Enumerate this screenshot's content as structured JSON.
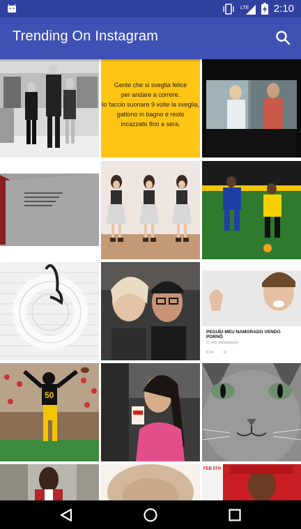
{
  "status_bar": {
    "time": "2:10",
    "network": "LTE",
    "icons": [
      "android-notification-icon",
      "vibrate-icon",
      "lte-signal-icon",
      "battery-charging-icon"
    ]
  },
  "app_bar": {
    "title": "Trending On Instagram",
    "search_icon": "search-icon"
  },
  "tiles": [
    {
      "subject": "fashion-group-photo"
    },
    {
      "subject": "quote-card",
      "quote_lines": [
        "Gente che si sveglia felice",
        "per andare a correre.",
        "Io faccio suonare 9 volte la sveglia,",
        "gattono in bagno e resto",
        "incazzato fino a sera."
      ]
    },
    {
      "subject": "tv-show-still"
    },
    {
      "subject": "notebook-photo"
    },
    {
      "subject": "mirror-selfie-collage"
    },
    {
      "subject": "soccer-match"
    },
    {
      "subject": "lifebuoy-on-wall"
    },
    {
      "subject": "couple-selfie"
    },
    {
      "subject": "video-thumbnail",
      "caption": "PEGUEI MEU NAMORADO VENDO PORNÔ",
      "sub": "27.400 visualizações",
      "likes": "8 mil",
      "comments": "67"
    },
    {
      "subject": "football-player"
    },
    {
      "subject": "car-selfie-coffee"
    },
    {
      "subject": "cat-closeup"
    },
    {
      "subject": "man-portrait"
    },
    {
      "subject": "lion-closeup"
    },
    {
      "subject": "magazine-cover",
      "cover_text": "FEB 5TH"
    }
  ],
  "nav_bar": {
    "back_icon": "back-triangle-icon",
    "home_icon": "home-circle-icon",
    "recents_icon": "recents-square-icon"
  },
  "colors": {
    "status_bar": "#30409f",
    "app_bar": "#3f51b5",
    "quote_bg": "#ffc515",
    "nav_bar": "#000000"
  }
}
